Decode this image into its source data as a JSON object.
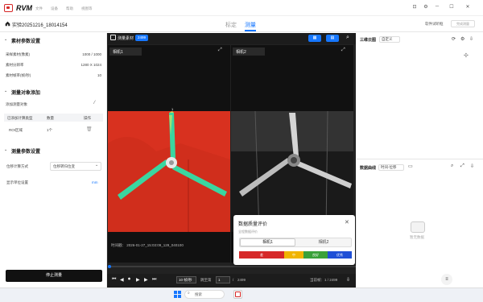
{
  "app": {
    "name": "RVM"
  },
  "menu": [
    "文件",
    "设备",
    "帮助",
    "视图等"
  ],
  "project": {
    "name": "实验20251216_18014154"
  },
  "mode_tabs": [
    {
      "label": "标定"
    },
    {
      "label": "测量"
    }
  ],
  "header": {
    "help_label": "软件试听框",
    "export_label": "完成测量"
  },
  "left": {
    "material_section": {
      "title": "素材参数设置",
      "rows": [
        {
          "label": "采样素材(像素)",
          "value": "1000 / 1000"
        },
        {
          "label": "素材分辨率",
          "value": "1280 X 1024"
        },
        {
          "label": "素材帧率(帧/秒)",
          "value": "10"
        }
      ]
    },
    "objects_section": {
      "title": "测量对象添加",
      "add_label": "添加测量对象",
      "headers": [
        "已添加计算类型",
        "数量",
        "操作"
      ],
      "rows": [
        {
          "type": "ROI区域",
          "count": "1个"
        }
      ]
    },
    "params_section": {
      "title": "测量参数设置",
      "method_label": "位移计算方式",
      "method_value": "位移转归位变",
      "unit_label": "显示单位设置",
      "unit_value": "mm"
    },
    "stop_label": "停止测量"
  },
  "viewer": {
    "material_label": "测量素材",
    "frame_count": "2499",
    "cameras": [
      {
        "title": "相机1"
      },
      {
        "title": "相机2"
      }
    ],
    "timestamp": "时间戳： 2026-01-27_15:03:09_129_040100",
    "playback": {
      "speed": "10 帧/秒",
      "jump_label": "跳至第",
      "jump_value": "1",
      "jump_total": "2499",
      "current_label": "当前帧：1 / 2499",
      "progress": 0.005
    }
  },
  "popup": {
    "title": "数据质量评价",
    "subtitle": "全程数据评价",
    "segments": [
      "相机1",
      "相机2"
    ],
    "quality": [
      {
        "label": "差",
        "color": "#d62828"
      },
      {
        "label": "中",
        "color": "#f0b400"
      },
      {
        "label": "良好",
        "color": "#3aa13a"
      },
      {
        "label": "优秀",
        "color": "#1f4fd6"
      }
    ]
  },
  "right": {
    "cloud_title": "三维云图",
    "cloud_select": "自定义",
    "curve_title": "数据曲线",
    "curve_select": "时间-位移",
    "empty_text": "暂无数据"
  },
  "taskbar": {
    "search_placeholder": "搜索"
  },
  "colors": {
    "accent": "#1677ff",
    "brand": "#d62828"
  }
}
